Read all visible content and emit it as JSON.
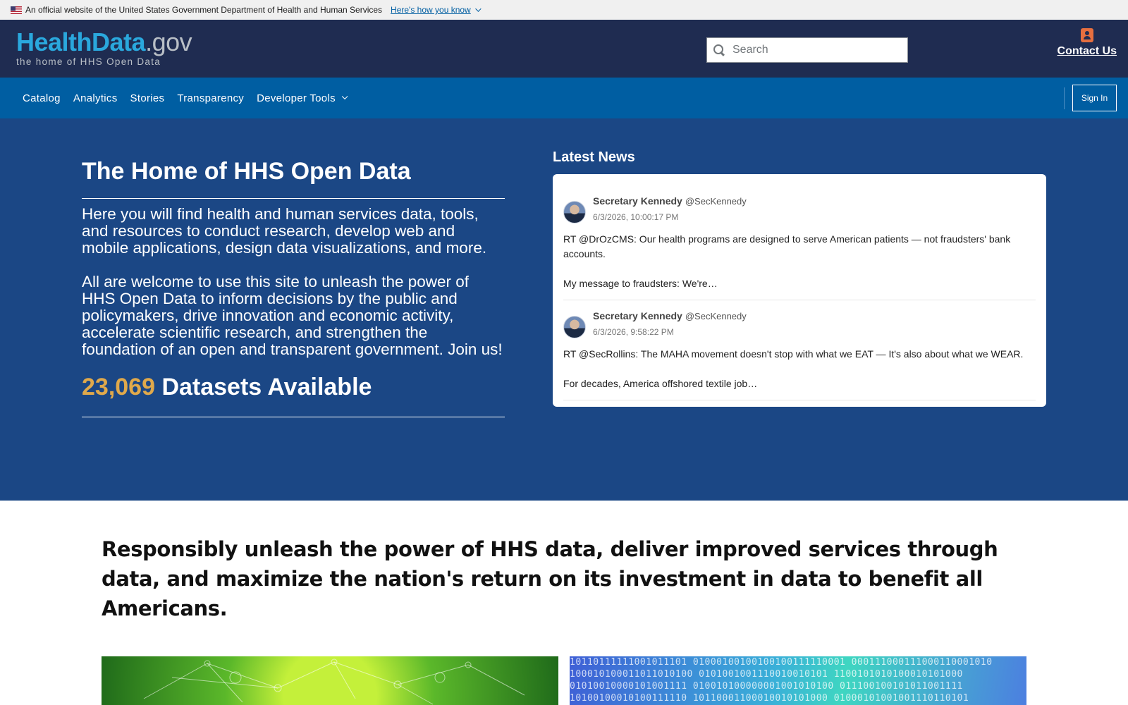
{
  "gov_banner": {
    "text": "An official website of the United States Government Department of Health and Human Services",
    "link": "Here's how you know"
  },
  "header": {
    "logo_main_a": "HealthData",
    "logo_main_b": ".gov",
    "logo_sub": "the home of HHS Open Data",
    "search_placeholder": "Search",
    "contact_label": "Contact Us"
  },
  "nav": {
    "items": [
      "Catalog",
      "Analytics",
      "Stories",
      "Transparency",
      "Developer Tools"
    ],
    "sign_in": "Sign In"
  },
  "hero": {
    "title": "The Home of HHS Open Data",
    "paragraph1": "Here you will find health and human services data, tools, and resources to conduct research, develop web and mobile applications, design data visualizations, and more.",
    "paragraph2": "All are welcome to use this site to unleash the power of HHS Open Data to inform decisions by the public and policymakers, drive innovation and economic activity, accelerate scientific research, and strengthen the foundation of an open and transparent government. Join us!",
    "dataset_count": "23,069",
    "dataset_label": "Datasets Available"
  },
  "news": {
    "heading": "Latest News",
    "tweets": [
      {
        "name": "Secretary Kennedy",
        "handle": "@SecKennedy",
        "time": "6/3/2026, 10:00:17 PM",
        "text": "RT @DrOzCMS: Our health programs are designed to serve American patients — not fraudsters' bank accounts.\n\nMy message to fraudsters: We're…"
      },
      {
        "name": "Secretary Kennedy",
        "handle": "@SecKennedy",
        "time": "6/3/2026, 9:58:22 PM",
        "text": "RT @SecRollins: The MAHA movement doesn't stop with what we EAT — It's also about what we WEAR.\n\nFor decades, America offshored textile job…"
      }
    ]
  },
  "mission": "Responsibly unleash the power of HHS data, deliver improved services through data, and maximize the nation's return on its investment in data to benefit all Americans.",
  "colors": {
    "header_bg": "#1f2c51",
    "nav_bg": "#005ea2",
    "hero_bg": "#1b4785",
    "accent_gold": "#e0a94b",
    "logo_blue": "#2aa8dd"
  },
  "icons": [
    "us-flag-icon",
    "chevron-down-icon",
    "search-icon",
    "contact-icon"
  ]
}
